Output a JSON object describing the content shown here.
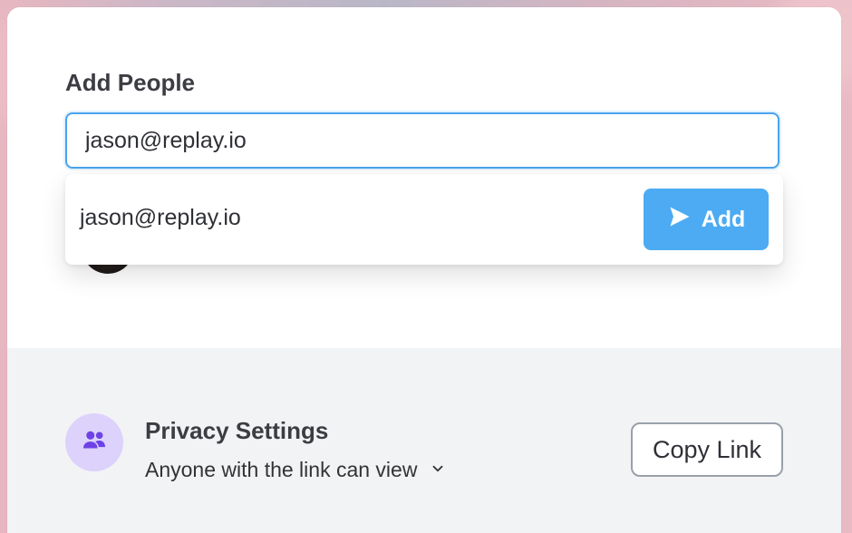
{
  "share_modal": {
    "title": "Add People",
    "search": {
      "value": "jason@replay.io",
      "placeholder": ""
    },
    "suggestion": {
      "email": "jason@replay.io",
      "button_label": "Add",
      "button_icon": "send-icon"
    },
    "privacy": {
      "title": "Privacy Settings",
      "option": "Anyone with the link can view",
      "icon": "people-icon"
    },
    "copy_link_label": "Copy Link"
  },
  "colors": {
    "accent": "#4cabf3",
    "input_border": "#4aa3ee",
    "privacy_icon_bg": "#ddd2fb",
    "privacy_icon": "#6c42e7",
    "footer_bg": "#f2f3f5"
  }
}
